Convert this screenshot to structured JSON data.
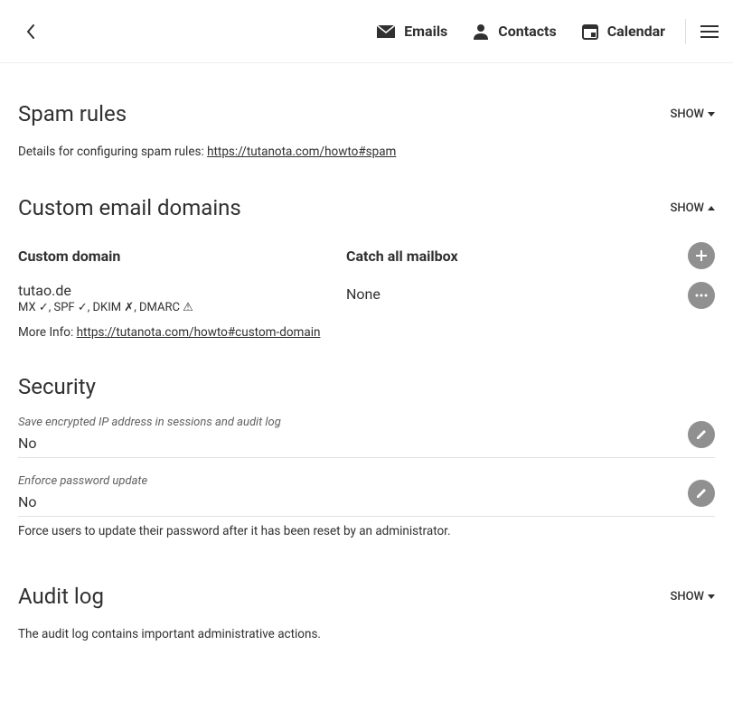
{
  "nav": {
    "emails": "Emails",
    "contacts": "Contacts",
    "calendar": "Calendar"
  },
  "spam": {
    "title": "Spam rules",
    "toggle": "SHOW",
    "desc_prefix": "Details for configuring spam rules: ",
    "link": "https://tutanota.com/howto#spam"
  },
  "domains": {
    "title": "Custom email domains",
    "toggle": "SHOW",
    "col_domain": "Custom domain",
    "col_catchall": "Catch all mailbox",
    "rows": [
      {
        "domain": "tutao.de",
        "status": "MX ✓, SPF ✓, DKIM ✗, DMARC ⚠",
        "catchall": "None"
      }
    ],
    "more_info_prefix": "More Info: ",
    "more_info_link": "https://tutanota.com/howto#custom-domain"
  },
  "security": {
    "title": "Security",
    "ip_label": "Save encrypted IP address in sessions and audit log",
    "ip_value": "No",
    "pw_label": "Enforce password update",
    "pw_value": "No",
    "pw_help": "Force users to update their password after it has been reset by an administrator."
  },
  "audit": {
    "title": "Audit log",
    "toggle": "SHOW",
    "desc": "The audit log contains important administrative actions."
  }
}
